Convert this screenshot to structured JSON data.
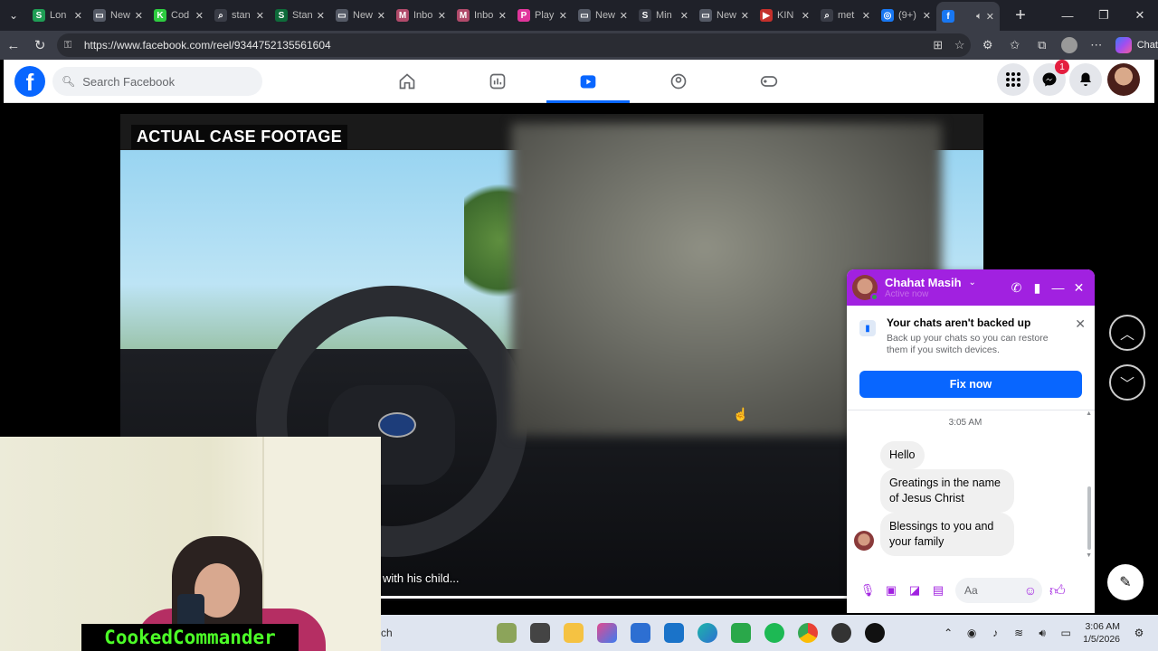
{
  "browser": {
    "tabs": [
      {
        "label": "Lon",
        "fav_color": "#1f9d55",
        "fav_glyph": "S"
      },
      {
        "label": "New",
        "fav_color": "#555a66",
        "fav_glyph": "▭"
      },
      {
        "label": "Cod",
        "fav_color": "#2ecc40",
        "fav_glyph": "K"
      },
      {
        "label": "stan",
        "fav_color": "#3a3d47",
        "fav_glyph": "⌕"
      },
      {
        "label": "Stan",
        "fav_color": "#0e6b3a",
        "fav_glyph": "S"
      },
      {
        "label": "New",
        "fav_color": "#555a66",
        "fav_glyph": "▭"
      },
      {
        "label": "Inbo",
        "fav_color": "#b04a6a",
        "fav_glyph": "M"
      },
      {
        "label": "Inbo",
        "fav_color": "#b04a6a",
        "fav_glyph": "M"
      },
      {
        "label": "Play",
        "fav_color": "#e0359b",
        "fav_glyph": "P"
      },
      {
        "label": "New",
        "fav_color": "#555a66",
        "fav_glyph": "▭"
      },
      {
        "label": "Min",
        "fav_color": "#3a3d47",
        "fav_glyph": "S"
      },
      {
        "label": "New",
        "fav_color": "#555a66",
        "fav_glyph": "▭"
      },
      {
        "label": "KIN",
        "fav_color": "#c4302b",
        "fav_glyph": "▶"
      },
      {
        "label": "met",
        "fav_color": "#3a3d47",
        "fav_glyph": "⌕"
      },
      {
        "label": "(9+)",
        "fav_color": "#1877f2",
        "fav_glyph": "◎"
      },
      {
        "label": "",
        "fav_color": "#1877f2",
        "fav_glyph": "f",
        "active": true
      }
    ],
    "url": "https://www.facebook.com/reel/934475213556160​4",
    "chat_label": "Chat"
  },
  "facebook": {
    "search_placeholder": "Search Facebook",
    "messenger_badge": "1"
  },
  "video": {
    "overlay_title": "ACTUAL CASE FOOTAGE",
    "caption": "with his child...",
    "progress": 0.85
  },
  "webcam": {
    "streamer_name": "CookedCommander"
  },
  "chat": {
    "contact_name": "Chahat Masih",
    "status": "Active now",
    "backup_title": "Your chats aren't backed up",
    "backup_desc": "Back up your chats so you can restore them if you switch devices.",
    "fix_label": "Fix now",
    "time": "3:05 AM",
    "messages": [
      "Hello",
      "Greatings in the name of Jesus Christ",
      "Blessings to you and your family"
    ],
    "input_placeholder": "Aa"
  },
  "taskbar": {
    "search_fragment": "ch",
    "time": "3:06 AM",
    "date": "1/5/2026"
  },
  "colors": {
    "fb_blue": "#0866ff",
    "messenger_purple": "#a121e0",
    "gamer_green": "#4cff27"
  }
}
